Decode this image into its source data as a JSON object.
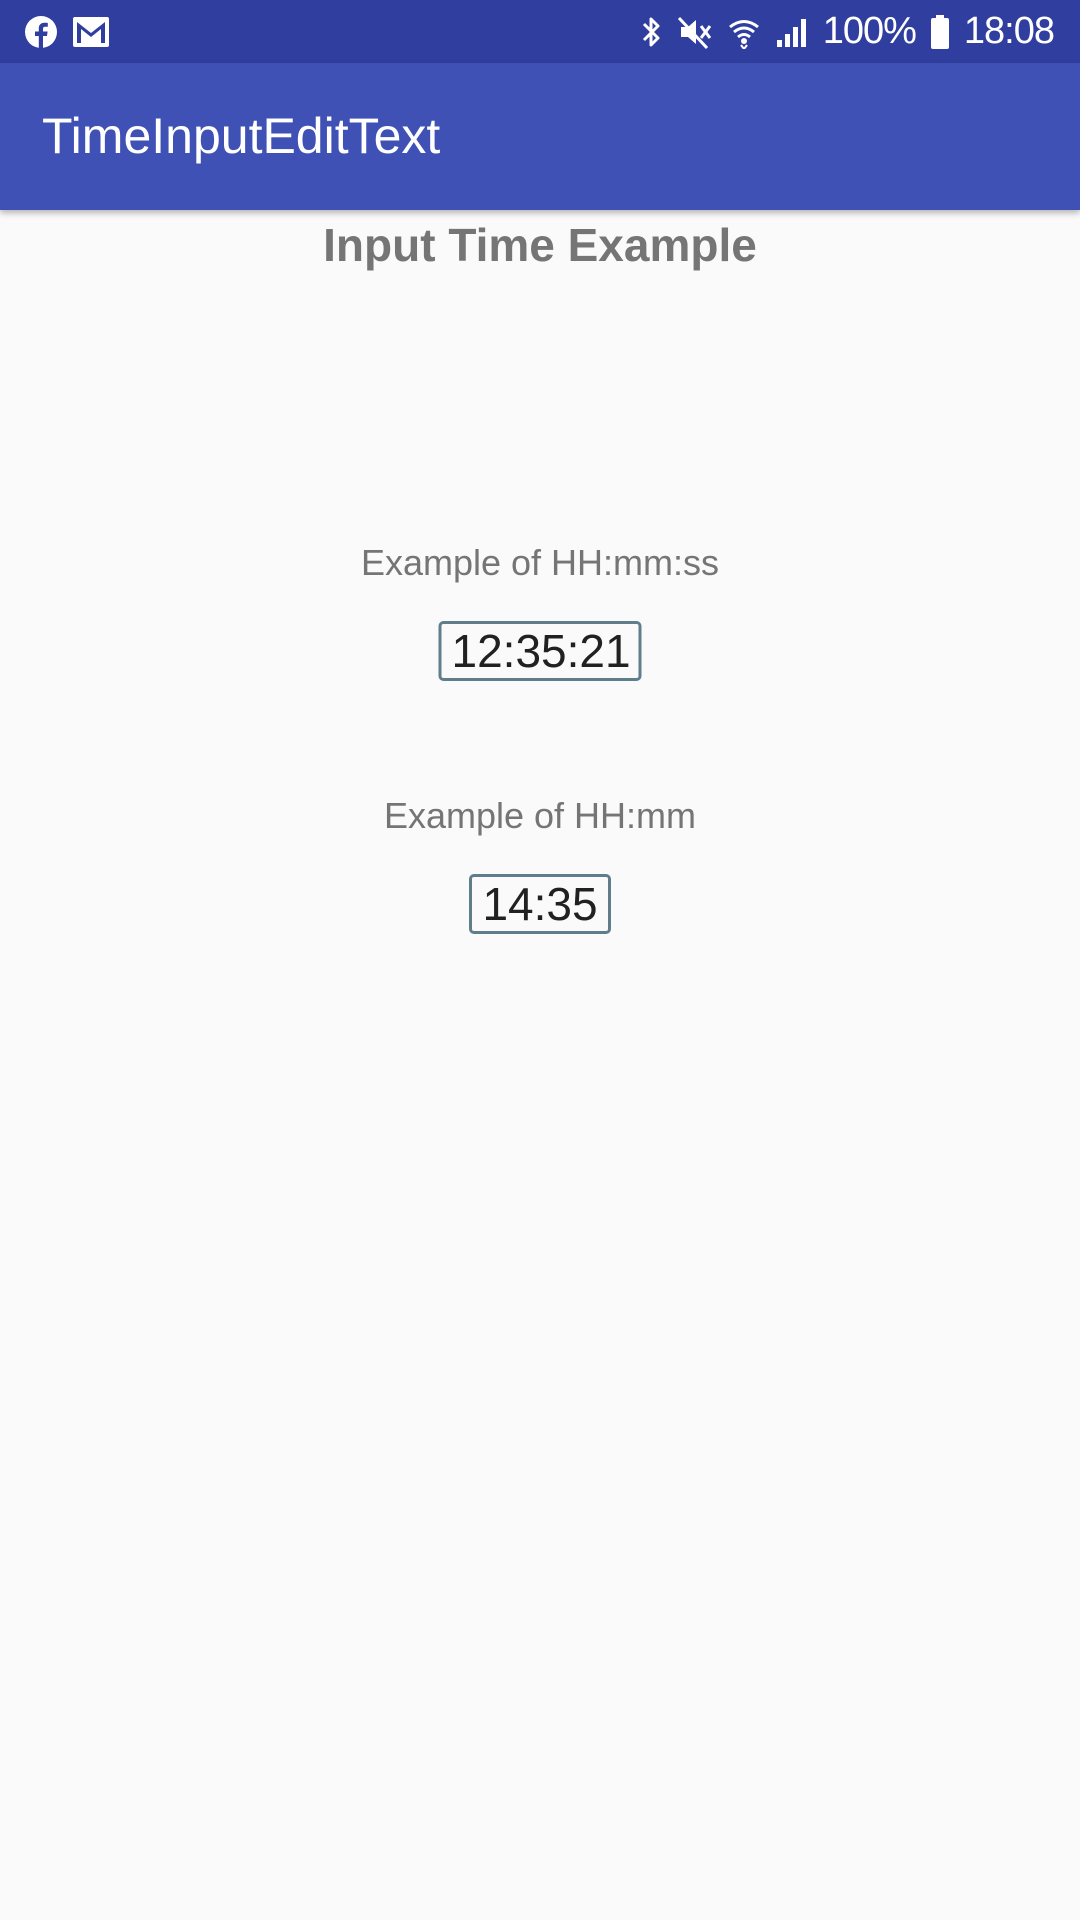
{
  "status_bar": {
    "battery_text": "100%",
    "time": "18:08",
    "left_icons": [
      "facebook-icon",
      "gmail-icon"
    ],
    "right_icons": [
      "bluetooth-icon",
      "vibrate-icon",
      "wifi-icon",
      "signal-icon",
      "battery-icon"
    ]
  },
  "app_bar": {
    "title": "TimeInputEditText",
    "color": "#3f51b5",
    "status_color": "#303f9f"
  },
  "main": {
    "heading": "Input Time Example",
    "fields": [
      {
        "label": "Example of HH:mm:ss",
        "value": "12:35:21"
      },
      {
        "label": "Example of HH:mm",
        "value": "14:35"
      }
    ]
  }
}
